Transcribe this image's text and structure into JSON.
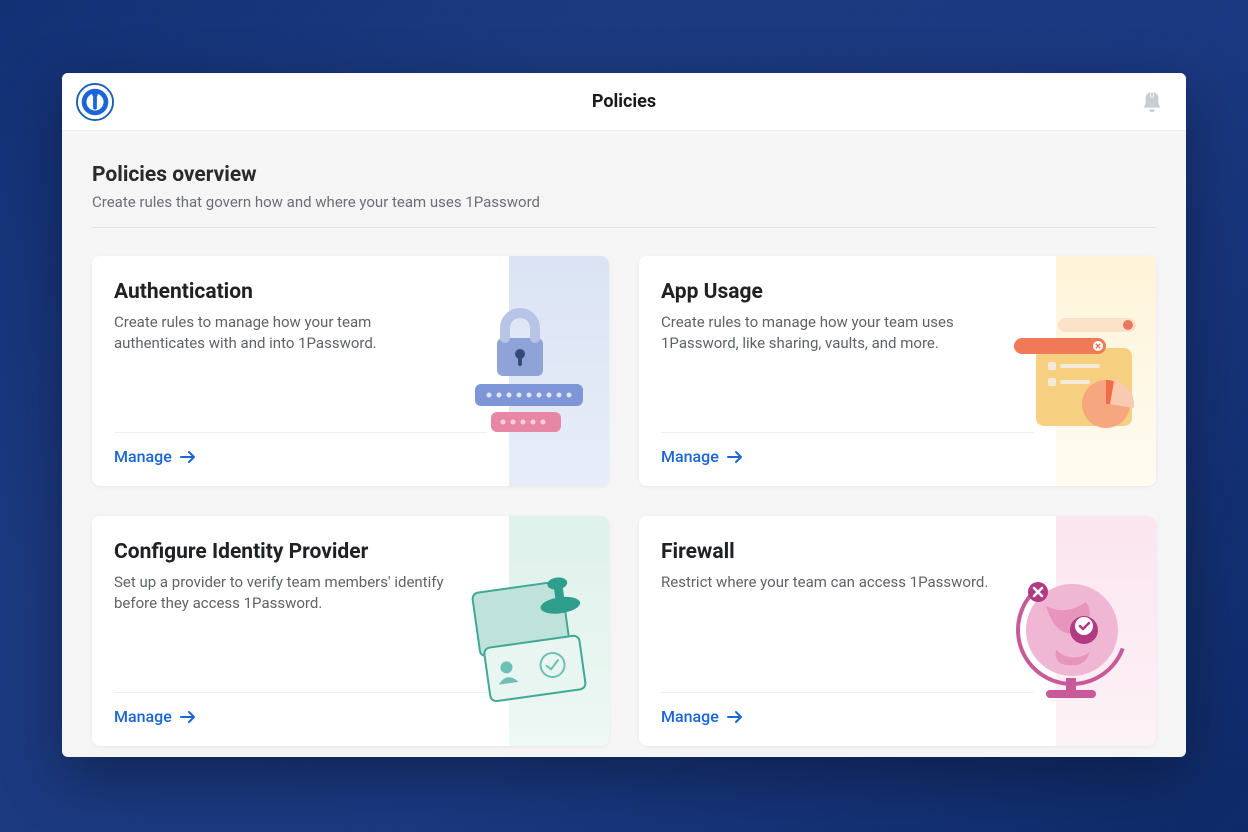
{
  "header": {
    "title": "Policies",
    "notification_count": "0"
  },
  "overview": {
    "title": "Policies overview",
    "subtitle": "Create rules that govern how and where your team uses 1Password"
  },
  "cards": {
    "authentication": {
      "title": "Authentication",
      "desc": "Create rules to manage how your team authenticates with and into 1Password.",
      "manage": "Manage"
    },
    "appusage": {
      "title": "App Usage",
      "desc": "Create rules to manage how your team uses 1Password, like sharing, vaults, and more.",
      "manage": "Manage"
    },
    "idp": {
      "title": "Configure Identity Provider",
      "desc": "Set up a provider to verify team members' identify before they access 1Password.",
      "manage": "Manage"
    },
    "firewall": {
      "title": "Firewall",
      "desc": "Restrict where your team can access 1Password.",
      "manage": "Manage"
    }
  }
}
